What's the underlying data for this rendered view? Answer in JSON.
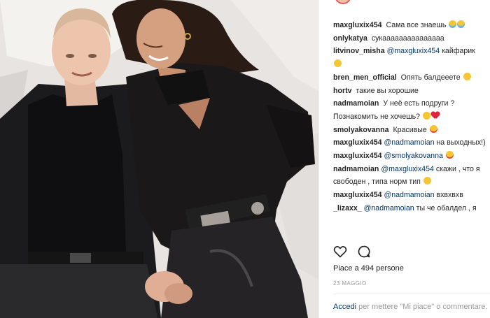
{
  "comments": [
    {
      "user": "maxgluxix454",
      "text": " Сама все знаешь",
      "emoji": [
        "cry",
        "cry"
      ]
    },
    {
      "user": "onlykatya",
      "text": " сукааааааааааааааа",
      "emoji": []
    },
    {
      "user": "litvinov_misha",
      "mention": "@maxgluxix454",
      "text": " кайфарик",
      "emoji": [
        "laugh"
      ]
    },
    {
      "user": "bren_men_official",
      "text": " Опять балдееете",
      "emoji": [
        "laugh"
      ]
    },
    {
      "user": "hortv",
      "text": " такие вы хорошие",
      "emoji": []
    },
    {
      "user": "nadmamoian",
      "text": " У неё есть подруги ? Познакомить не хочешь?",
      "emoji": [
        "laugh",
        "heart"
      ]
    },
    {
      "user": "smolyakovanna",
      "text": " Красивые",
      "emoji": [
        "heart-eyes"
      ]
    },
    {
      "user": "maxgluxix454",
      "mention": "@nadmamoian",
      "text": " на выходных!)",
      "emoji": []
    },
    {
      "user": "maxgluxix454",
      "mention": "@smolyakovanna",
      "text": "",
      "emoji": [
        "heart-eyes"
      ]
    },
    {
      "user": "nadmamoian",
      "mention": "@maxgluxix454",
      "text": " скажи , что я свободен , типа норм тип",
      "emoji": [
        "laugh"
      ]
    },
    {
      "user": "maxgluxix454",
      "mention": "@nadmamoian",
      "text": " вхвхвхв",
      "emoji": []
    },
    {
      "user": "_lizaxx_",
      "mention": "@nadmamoian",
      "text": " ты че обалдел , я",
      "emoji": []
    }
  ],
  "likes_text": "Piace a 494 persone",
  "date_text": "23 MAGGIO",
  "login": {
    "link": "Accedi",
    "text": " per mettere \"Mi piace\" o commentare."
  },
  "icons": {
    "like": "heart-outline-icon",
    "comment": "speech-bubble-icon"
  },
  "colors": {
    "link": "#003569",
    "muted": "#999999",
    "text": "#262626"
  }
}
